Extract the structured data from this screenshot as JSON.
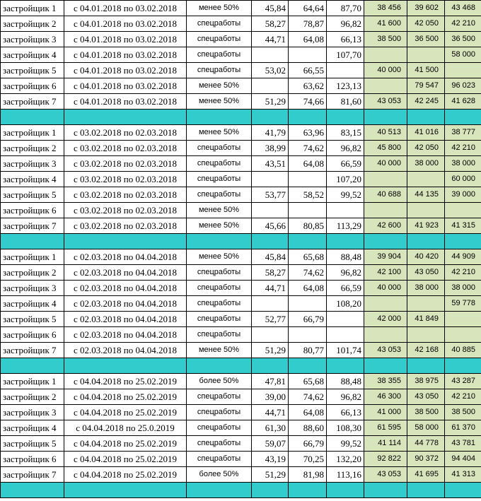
{
  "colors": {
    "separator": "#33cccc",
    "price_bg": "#d8e4bc"
  },
  "groups": [
    {
      "rows": [
        {
          "name": "застройщик 1",
          "period": "с 04.01.2018 по 03.02.2018",
          "cat": "менее 50%",
          "v1": "45,84",
          "v2": "64,64",
          "v3": "87,70",
          "p1": "38 456",
          "p2": "39 602",
          "p3": "43 468"
        },
        {
          "name": "застройщик 2",
          "period": "с 04.01.2018 по 03.02.2018",
          "cat": "спецработы",
          "v1": "58,27",
          "v2": "78,87",
          "v3": "96,82",
          "p1": "41 600",
          "p2": "42 050",
          "p3": "42 210"
        },
        {
          "name": "застройщик 3",
          "period": "с 04.01.2018 по 03.02.2018",
          "cat": "спецработы",
          "v1": "44,71",
          "v2": "64,08",
          "v3": "66,13",
          "p1": "38 500",
          "p2": "36 500",
          "p3": "36 500"
        },
        {
          "name": "застройщик 4",
          "period": "с 04.01.2018 по 03.02.2018",
          "cat": "спецработы",
          "v1": "",
          "v2": "",
          "v3": "107,70",
          "p1": "",
          "p2": "",
          "p3": "58 000"
        },
        {
          "name": "застройщик 5",
          "period": "с 04.01.2018 по 03.02.2018",
          "cat": "спецработы",
          "v1": "53,02",
          "v2": "66,55",
          "v3": "",
          "p1": "40 000",
          "p2": "41 500",
          "p3": ""
        },
        {
          "name": "застройщик 6",
          "period": "с 04.01.2018 по 03.02.2018",
          "cat": "менее 50%",
          "v1": "",
          "v2": "63,62",
          "v3": "123,13",
          "p1": "",
          "p2": "79 547",
          "p3": "96 023"
        },
        {
          "name": "застройщик 7",
          "period": "с 04.01.2018 по 03.02.2018",
          "cat": "менее 50%",
          "v1": "51,29",
          "v2": "74,66",
          "v3": "81,60",
          "p1": "43 053",
          "p2": "42 245",
          "p3": "41 628"
        }
      ]
    },
    {
      "rows": [
        {
          "name": "застройщик 1",
          "period": "с 03.02.2018 по 02.03.2018",
          "cat": "менее 50%",
          "v1": "41,79",
          "v2": "63,96",
          "v3": "83,15",
          "p1": "40 513",
          "p2": "41 016",
          "p3": "38 777"
        },
        {
          "name": "застройщик 2",
          "period": "с 03.02.2018 по 02.03.2018",
          "cat": "спецработы",
          "v1": "38,99",
          "v2": "74,62",
          "v3": "96,82",
          "p1": "45 800",
          "p2": "42 050",
          "p3": "42 210"
        },
        {
          "name": "застройщик 3",
          "period": "с 03.02.2018 по 02.03.2018",
          "cat": "спецработы",
          "v1": "43,51",
          "v2": "64,08",
          "v3": "66,59",
          "p1": "40 000",
          "p2": "38 000",
          "p3": "38 000"
        },
        {
          "name": "застройщик 4",
          "period": "с 03.02.2018 по 02.03.2018",
          "cat": "спецработы",
          "v1": "",
          "v2": "",
          "v3": "107,20",
          "p1": "",
          "p2": "",
          "p3": "60 000"
        },
        {
          "name": "застройщик 5",
          "period": "с 03.02.2018 по 02.03.2018",
          "cat": "спецработы",
          "v1": "53,77",
          "v2": "58,52",
          "v3": "99,52",
          "p1": "40 688",
          "p2": "44 135",
          "p3": "39 000"
        },
        {
          "name": "застройщик 6",
          "period": "с 03.02.2018 по 02.03.2018",
          "cat": "менее 50%",
          "v1": "",
          "v2": "",
          "v3": "",
          "p1": "",
          "p2": "",
          "p3": ""
        },
        {
          "name": "застройщик 7",
          "period": "с 03.02.2018 по 02.03.2018",
          "cat": "менее 50%",
          "v1": "45,66",
          "v2": "80,85",
          "v3": "113,29",
          "p1": "42 600",
          "p2": "41 923",
          "p3": "41 315"
        }
      ]
    },
    {
      "rows": [
        {
          "name": "застройщик 1",
          "period": "с 02.03.2018 по 04.04.2018",
          "cat": "менее 50%",
          "v1": "45,84",
          "v2": "65,68",
          "v3": "88,48",
          "p1": "39 904",
          "p2": "40 420",
          "p3": "44 909"
        },
        {
          "name": "застройщик 2",
          "period": "с 02.03.2018 по 04.04.2018",
          "cat": "спецработы",
          "v1": "58,27",
          "v2": "74,62",
          "v3": "96,82",
          "p1": "42 100",
          "p2": "43 050",
          "p3": "42 210"
        },
        {
          "name": "застройщик 3",
          "period": "с 02.03.2018 по 04.04.2018",
          "cat": "спецработы",
          "v1": "44,71",
          "v2": "64,08",
          "v3": "66,59",
          "p1": "40 000",
          "p2": "38 000",
          "p3": "38 000"
        },
        {
          "name": "застройщик 4",
          "period": "с 02.03.2018 по 04.04.2018",
          "cat": "спецработы",
          "v1": "",
          "v2": "",
          "v3": "108,20",
          "p1": "",
          "p2": "",
          "p3": "59 778"
        },
        {
          "name": "застройщик 5",
          "period": "с 02.03.2018 по 04.04.2018",
          "cat": "спецработы",
          "v1": "52,77",
          "v2": "66,79",
          "v3": "",
          "p1": "42 000",
          "p2": "41 849",
          "p3": ""
        },
        {
          "name": "застройщик 6",
          "period": "с 02.03.2018 по 04.04.2018",
          "cat": "спецработы",
          "v1": "",
          "v2": "",
          "v3": "",
          "p1": "",
          "p2": "",
          "p3": ""
        },
        {
          "name": "застройщик 7",
          "period": "с 02.03.2018 по 04.04.2018",
          "cat": "менее 50%",
          "v1": "51,29",
          "v2": "80,77",
          "v3": "101,74",
          "p1": "43 053",
          "p2": "42 168",
          "p3": "40 885"
        }
      ]
    },
    {
      "rows": [
        {
          "name": "застройщик 1",
          "period": "с 04.04.2018 по 25.02.2019",
          "cat": "более 50%",
          "v1": "47,81",
          "v2": "65,68",
          "v3": "88,48",
          "p1": "38 355",
          "p2": "38 975",
          "p3": "43 287"
        },
        {
          "name": "застройщик 2",
          "period": "с 04.04.2018 по 25.02.2019",
          "cat": "спецработы",
          "v1": "39,00",
          "v2": "74,62",
          "v3": "96,82",
          "p1": "46 300",
          "p2": "43 050",
          "p3": "42 210"
        },
        {
          "name": "застройщик 3",
          "period": "с 04.04.2018 по 25.02.2019",
          "cat": "спецработы",
          "v1": "44,71",
          "v2": "64,08",
          "v3": "66,13",
          "p1": "41 000",
          "p2": "38 500",
          "p3": "38 500"
        },
        {
          "name": "застройщик 4",
          "period": "с 04.04.2018 по 25.0.2019",
          "cat": "спецработы",
          "v1": "61,30",
          "v2": "88,60",
          "v3": "108,30",
          "p1": "61 595",
          "p2": "58 000",
          "p3": "61 370"
        },
        {
          "name": "застройщик 5",
          "period": "с 04.04.2018 по 25.02.2019",
          "cat": "спецработы",
          "v1": "59,07",
          "v2": "66,79",
          "v3": "99,52",
          "p1": "41 114",
          "p2": "44 778",
          "p3": "43 781"
        },
        {
          "name": "застройщик 6",
          "period": "с 04.04.2018 по 25.02.2019",
          "cat": "спецработы",
          "v1": "43,19",
          "v2": "70,25",
          "v3": "132,20",
          "p1": "92 822",
          "p2": "90 372",
          "p3": "94 404"
        },
        {
          "name": "застройщик 7",
          "period": "с 04.04.2018 по 25.02.2019",
          "cat": "более 50%",
          "v1": "51,29",
          "v2": "81,98",
          "v3": "113,16",
          "p1": "43 053",
          "p2": "41 695",
          "p3": "41 313"
        }
      ]
    }
  ]
}
